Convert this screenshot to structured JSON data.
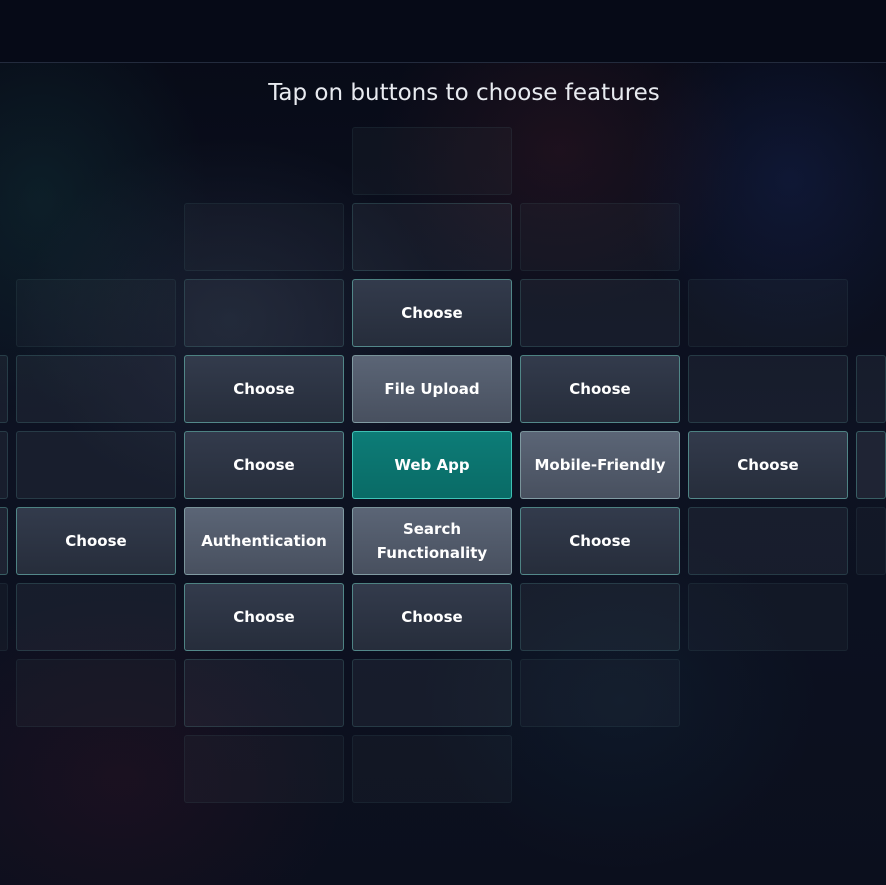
{
  "header": {
    "title": "Tap on buttons to choose features"
  },
  "rows": [
    [
      {
        "id": "r1c3",
        "level": "l1"
      }
    ],
    [
      {
        "id": "r2c2",
        "level": "l1"
      },
      {
        "id": "r2c3",
        "level": "l2"
      },
      {
        "id": "r2c4",
        "level": "l1"
      }
    ],
    [
      {
        "id": "r3c1",
        "level": "l1"
      },
      {
        "id": "r3c2",
        "level": "l2"
      },
      {
        "id": "r3c3",
        "level": "btn",
        "label": "Choose"
      },
      {
        "id": "r3c4",
        "level": "l2"
      },
      {
        "id": "r3c5",
        "level": "l1"
      }
    ],
    [
      {
        "id": "r4c0",
        "level": "l2",
        "partial": "left"
      },
      {
        "id": "r4c1",
        "level": "l2"
      },
      {
        "id": "r4c2",
        "level": "btn",
        "label": "Choose"
      },
      {
        "id": "r4c3",
        "level": "sel",
        "label": "File Upload"
      },
      {
        "id": "r4c4",
        "level": "btn",
        "label": "Choose"
      },
      {
        "id": "r4c5",
        "level": "l2"
      },
      {
        "id": "r4c6",
        "level": "l2",
        "partial": "right"
      }
    ],
    [
      {
        "id": "r5c0",
        "level": "l2",
        "partial": "left"
      },
      {
        "id": "r5c1",
        "level": "l2"
      },
      {
        "id": "r5c2",
        "level": "btn",
        "label": "Choose"
      },
      {
        "id": "r5c3",
        "level": "main",
        "label": "Web App"
      },
      {
        "id": "r5c4",
        "level": "sel",
        "label": "Mobile-Friendly"
      },
      {
        "id": "r5c5",
        "level": "btn",
        "label": "Choose"
      },
      {
        "id": "r5c6",
        "level": "l3",
        "partial": "right"
      }
    ],
    [
      {
        "id": "r6c0",
        "level": "l3",
        "partial": "left"
      },
      {
        "id": "r6c1",
        "level": "btn",
        "label": "Choose"
      },
      {
        "id": "r6c2",
        "level": "sel",
        "label": "Authentication"
      },
      {
        "id": "r6c3",
        "level": "sel",
        "label": "Search Functionality"
      },
      {
        "id": "r6c4",
        "level": "btn",
        "label": "Choose"
      },
      {
        "id": "r6c5",
        "level": "l2"
      },
      {
        "id": "r6c6",
        "level": "l1",
        "partial": "right"
      }
    ],
    [
      {
        "id": "r7c0",
        "level": "l1",
        "partial": "left"
      },
      {
        "id": "r7c1",
        "level": "l2"
      },
      {
        "id": "r7c2",
        "level": "btn",
        "label": "Choose"
      },
      {
        "id": "r7c3",
        "level": "btn",
        "label": "Choose"
      },
      {
        "id": "r7c4",
        "level": "l2"
      },
      {
        "id": "r7c5",
        "level": "l1"
      }
    ],
    [
      {
        "id": "r8c1",
        "level": "l1"
      },
      {
        "id": "r8c2",
        "level": "l2"
      },
      {
        "id": "r8c3",
        "level": "l2"
      },
      {
        "id": "r8c4",
        "level": "l1"
      }
    ],
    [
      {
        "id": "r9c2",
        "level": "l1"
      },
      {
        "id": "r9c3",
        "level": "l1"
      }
    ]
  ]
}
